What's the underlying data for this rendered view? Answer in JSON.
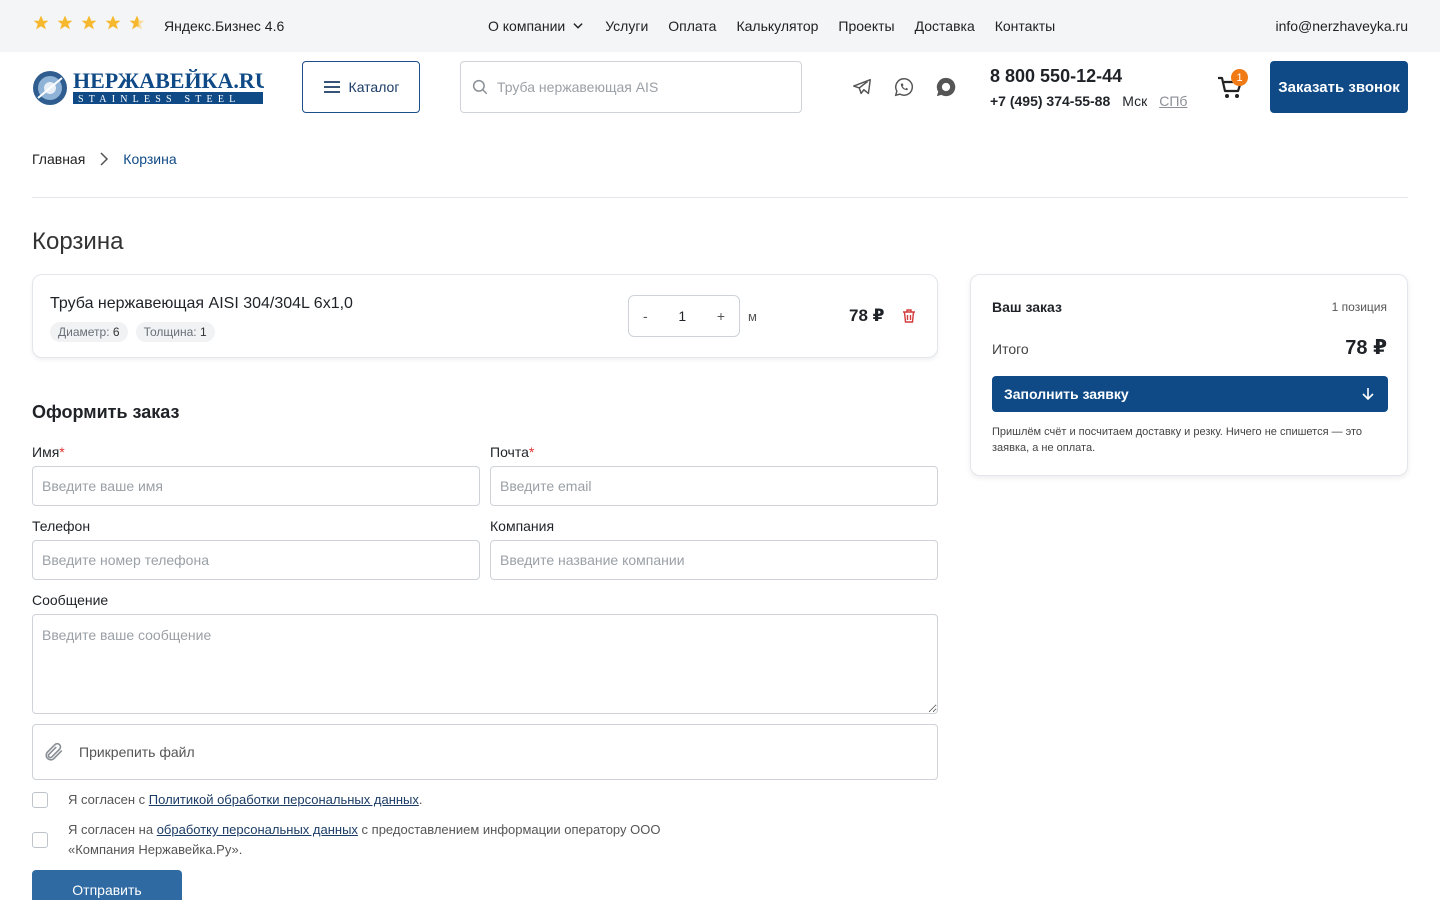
{
  "topbar": {
    "rating_stars": [
      1,
      1,
      1,
      1,
      0.6
    ],
    "rating_text": "Яндекс.Бизнес 4.6",
    "nav": [
      "О компании",
      "Услуги",
      "Оплата",
      "Калькулятор",
      "Проекты",
      "Доставка",
      "Контакты"
    ],
    "email": "info@nerzhaveyka.ru"
  },
  "header": {
    "logo_title": "НЕРЖАВЕЙКА.RU",
    "logo_subtitle": "STAINLESS STEEL",
    "catalog_label": "Каталог",
    "search_placeholder": "Труба нержавеющая AIS",
    "phone_main": "8 800 550-12-44",
    "phone_secondary": "+7 (495) 374-55-88",
    "city_active": "Мск",
    "city_other": "СПб",
    "cart_count": "1",
    "call_button": "Заказать звонок"
  },
  "breadcrumb": {
    "home": "Главная",
    "current": "Корзина"
  },
  "page_title": "Корзина",
  "cart_item": {
    "title": "Труба нержавеющая AISI 304/304L 6х1,0",
    "tags": [
      {
        "label": "Диаметр:",
        "value": "6"
      },
      {
        "label": "Толщина:",
        "value": "1"
      }
    ],
    "qty_minus": "-",
    "qty_value": "1",
    "qty_plus": "+",
    "unit": "м",
    "price": "78 ₽"
  },
  "order_form": {
    "title": "Оформить заказ",
    "name_label": "Имя",
    "name_placeholder": "Введите ваше имя",
    "email_label": "Почта",
    "email_placeholder": "Введите email",
    "phone_label": "Телефон",
    "phone_placeholder": "Введите номер телефона",
    "company_label": "Компания",
    "company_placeholder": "Введите название компании",
    "message_label": "Сообщение",
    "message_placeholder": "Введите ваше сообщение",
    "attach_label": "Прикрепить файл",
    "required_mark": "*",
    "consent1_prefix": "Я согласен с ",
    "consent1_link": "Политикой обработки персональных данных",
    "consent1_suffix": ".",
    "consent2_prefix": "Я согласен на ",
    "consent2_link": "обработку персональных данных",
    "consent2_suffix": " с предоставлением информации оператору ООО «Компания Нержавейка.Ру».",
    "submit_label": "Отправить"
  },
  "summary": {
    "title": "Ваш заказ",
    "count": "1 позиция",
    "total_label": "Итого",
    "total": "78 ₽",
    "fill_button": "Заполнить заявку",
    "note": "Пришлём счёт и посчитаем доставку и резку. Ничего не спишется — это заявка, а не оплата."
  },
  "colors": {
    "primary": "#0f4a86",
    "star": "#f5b82e",
    "badge": "#f07b16",
    "delete": "#d33b3b"
  }
}
